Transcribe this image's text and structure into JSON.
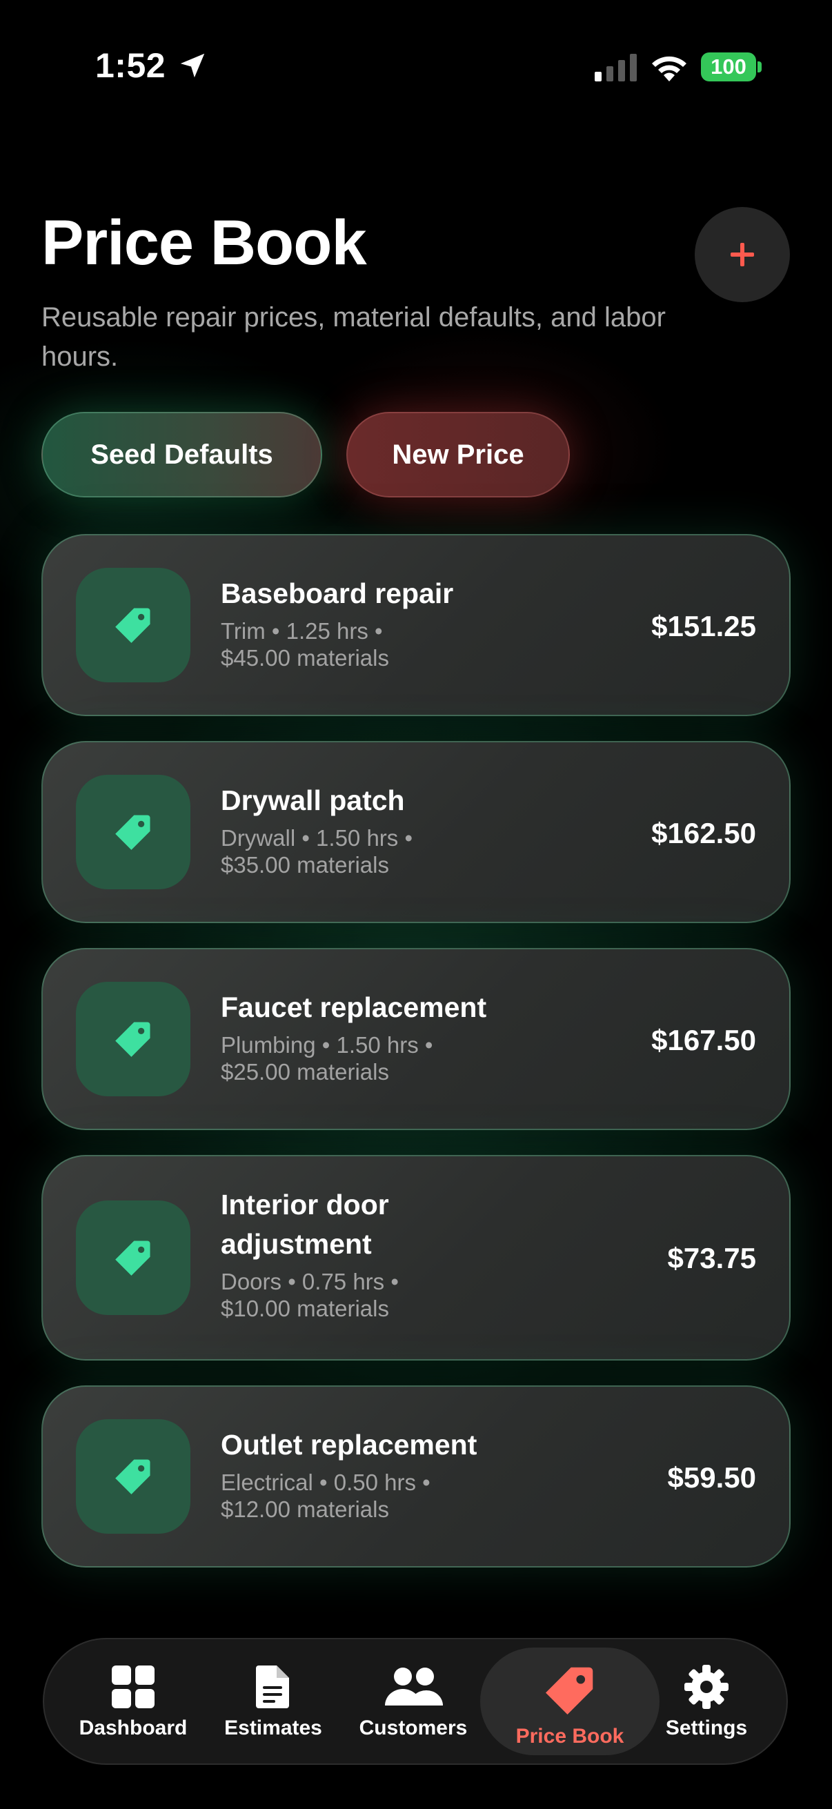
{
  "status_bar": {
    "time": "1:52",
    "battery": "100"
  },
  "header": {
    "title": "Price Book",
    "subtitle": "Reusable repair prices, material defaults, and labor hours."
  },
  "actions": {
    "seed_label": "Seed Defaults",
    "new_label": "New Price"
  },
  "items": [
    {
      "name": "Baseboard repair",
      "meta_line1": "Trim • 1.25 hrs •",
      "meta_line2": "$45.00 materials",
      "price": "$151.25"
    },
    {
      "name": "Drywall patch",
      "meta_line1": "Drywall • 1.50 hrs •",
      "meta_line2": "$35.00 materials",
      "price": "$162.50"
    },
    {
      "name": "Faucet replacement",
      "meta_line1": "Plumbing • 1.50 hrs •",
      "meta_line2": "$25.00 materials",
      "price": "$167.50"
    },
    {
      "name": "Interior door adjustment",
      "meta_line1": "Doors • 0.75 hrs •",
      "meta_line2": "$10.00 materials",
      "price": "$73.75"
    },
    {
      "name": "Outlet replacement",
      "meta_line1": "Electrical • 0.50 hrs •",
      "meta_line2": "$12.00 materials",
      "price": "$59.50"
    }
  ],
  "tabs": [
    {
      "label": "Dashboard",
      "icon": "grid-icon"
    },
    {
      "label": "Estimates",
      "icon": "document-icon"
    },
    {
      "label": "Customers",
      "icon": "people-icon"
    },
    {
      "label": "Price Book",
      "icon": "tag-icon",
      "active": true
    },
    {
      "label": "Settings",
      "icon": "gear-icon"
    }
  ],
  "colors": {
    "accent_red": "#ff6b5e",
    "accent_green": "#3ee0a0",
    "battery_green": "#34c759"
  }
}
